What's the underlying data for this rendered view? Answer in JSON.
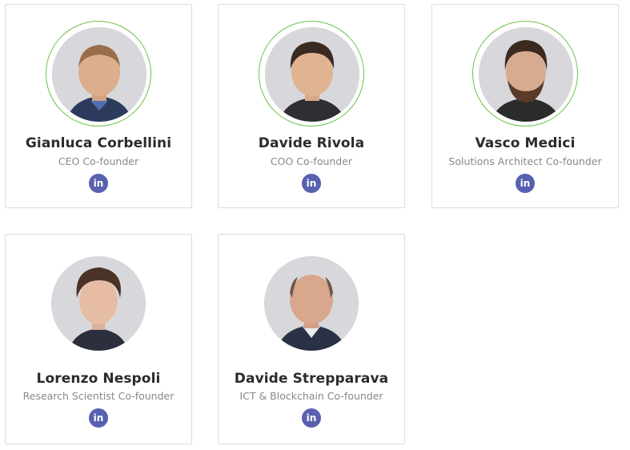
{
  "team": [
    {
      "name": "Gianluca Corbellini",
      "role": "CEO Co-founder",
      "linkedin_icon": "linkedin-icon",
      "linkedin_glyph": "in"
    },
    {
      "name": "Davide Rivola",
      "role": "COO Co-founder",
      "linkedin_icon": "linkedin-icon",
      "linkedin_glyph": "in"
    },
    {
      "name": "Vasco Medici",
      "role": "Solutions Architect Co-founder",
      "linkedin_icon": "linkedin-icon",
      "linkedin_glyph": "in"
    },
    {
      "name": "Lorenzo Nespoli",
      "role": "Research Scientist Co-founder",
      "linkedin_icon": "linkedin-icon",
      "linkedin_glyph": "in"
    },
    {
      "name": "Davide Strepparava",
      "role": "ICT & Blockchain Co-founder",
      "linkedin_icon": "linkedin-icon",
      "linkedin_glyph": "in"
    }
  ],
  "colors": {
    "accent_ring": "#6cc24a",
    "linkedin_button": "#5860b0",
    "name_text": "#2b2b2b",
    "role_text": "#888888",
    "card_border": "#dcdcdc"
  }
}
